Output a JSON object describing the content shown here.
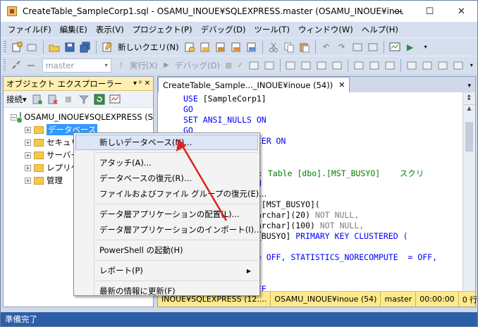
{
  "window": {
    "title": "CreateTable_SampleCorp1.sql - OSAMU_INOUE¥SQLEXPRESS.master (OSAMU_INOUE¥inoue (54...",
    "minimize": "—",
    "maximize": "☐",
    "close": "✕"
  },
  "menubar": [
    "ファイル(F)",
    "編集(E)",
    "表示(V)",
    "プロジェクト(P)",
    "デバッグ(D)",
    "ツール(T)",
    "ウィンドウ(W)",
    "ヘルプ(H)"
  ],
  "toolbar1": {
    "new_query": "新しいクエリ(N)"
  },
  "toolbar2": {
    "database": "master",
    "execute": "実行(X)",
    "debug": "デバッグ(D)"
  },
  "object_explorer": {
    "title": "オブジェクト エクスプローラー",
    "pin": "▾ ᵖ ✕",
    "connect": "接続▾",
    "tree": {
      "server": "OSAMU_INOUE¥SQLEXPRESS (S",
      "items": [
        "データベース",
        "セキュリ",
        "サーバー",
        "レプリケ",
        "管理"
      ]
    }
  },
  "editor": {
    "tab_title": "CreateTable_Sample..._INOUE¥inoue (54))",
    "tab_close": "✕",
    "code": [
      [
        {
          "t": "USE ",
          "c": "kw"
        },
        {
          "t": "[SampleCorp1]",
          "c": ""
        }
      ],
      [
        {
          "t": "GO",
          "c": "kw"
        }
      ],
      [
        {
          "t": "SET ANSI_NULLS ON",
          "c": "kw"
        }
      ],
      [
        {
          "t": "GO",
          "c": "kw"
        }
      ],
      [
        {
          "t": "            TIFIER ON",
          "c": "kw"
        }
      ],
      [
        {
          "t": "",
          "c": ""
        }
      ],
      [
        {
          "t": "",
          "c": ""
        }
      ],
      [
        {
          "t": "            クト: Table [dbo].[MST_BUSYO]    スクリ",
          "c": "cm"
        }
      ],
      [
        {
          "t": "            G ON",
          "c": "kw"
        }
      ],
      [
        {
          "t": "",
          "c": ""
        }
      ],
      [
        {
          "t": "            bo].[MST_BUSYO](",
          "c": ""
        }
      ],
      [
        {
          "t": "            [nvarchar](20) ",
          "c": ""
        },
        {
          "t": "NOT NULL,",
          "c": "gr"
        }
      ],
      [
        {
          "t": "            [nvarchar](100) ",
          "c": ""
        },
        {
          "t": "NOT NULL,",
          "c": "gr"
        }
      ],
      [
        {
          "t": "            MST_BUSYO] ",
          "c": ""
        },
        {
          "t": "PRIMARY KEY CLUSTERED (",
          "c": "kw"
        }
      ],
      [
        {
          "t": "            ASC",
          "c": "kw"
        }
      ],
      [
        {
          "t": "            X  = OFF, STATISTICS_NORECOMPUTE  = OFF,",
          "c": "kw"
        }
      ],
      [
        {
          "t": "",
          "c": ""
        }
      ],
      [
        {
          "t": "",
          "c": ""
        }
      ],
      [
        {
          "t": "            O OFF",
          "c": "kw"
        }
      ]
    ],
    "status": {
      "server": "INOUE¥SQLEXPRESS (12....",
      "user": "OSAMU_INOUE¥inoue (54)",
      "db": "master",
      "time": "00:00:00",
      "rows": "0 行"
    }
  },
  "context_menu": {
    "items": [
      {
        "label": "新しいデータベース(N)...",
        "highlight": true
      },
      {
        "sep": true
      },
      {
        "label": "アタッチ(A)..."
      },
      {
        "label": "データベースの復元(R)..."
      },
      {
        "label": "ファイルおよびファイル グループの復元(E)..."
      },
      {
        "sep": true
      },
      {
        "label": "データ層アプリケーションの配置(L)..."
      },
      {
        "label": "データ層アプリケーションのインポート(I)..."
      },
      {
        "sep": true
      },
      {
        "label": "PowerShell の起動(H)"
      },
      {
        "sep": true
      },
      {
        "label": "レポート(P)",
        "submenu": true
      },
      {
        "sep": true
      },
      {
        "label": "最新の情報に更新(F)"
      }
    ]
  },
  "statusbar": {
    "text": "準備完了"
  },
  "colors": {
    "accent": "#2d5ea8",
    "highlight": "#ffe98a",
    "arrow": "#e0201a"
  }
}
